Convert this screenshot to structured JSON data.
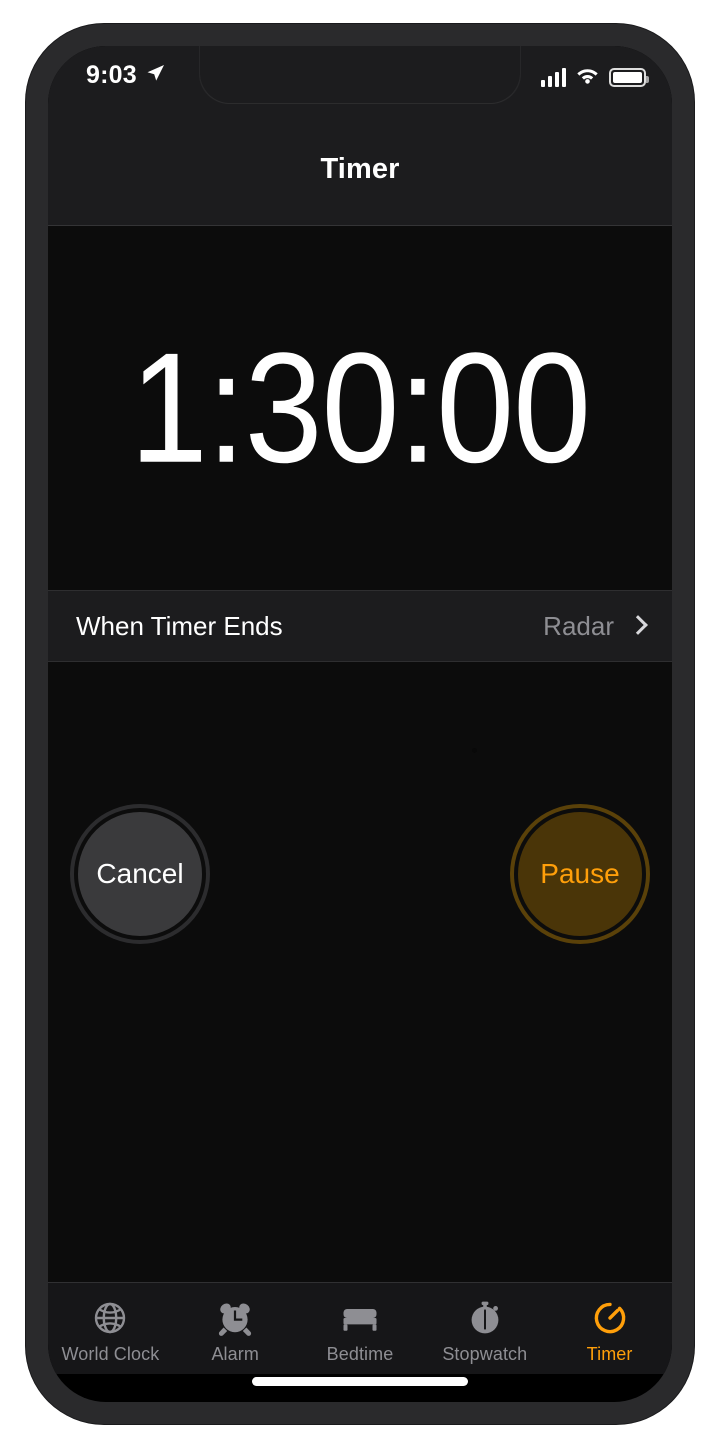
{
  "status_bar": {
    "time": "9:03",
    "location_icon": "location-arrow-icon",
    "signal_icon": "cellular-signal-icon",
    "signal_bars": 4,
    "wifi_icon": "wifi-icon",
    "battery_icon": "battery-full-icon"
  },
  "nav": {
    "title": "Timer"
  },
  "timer": {
    "readout": "1:30:00",
    "hours": "1",
    "minutes": "30",
    "seconds": "00"
  },
  "settings_row": {
    "label": "When Timer Ends",
    "value": "Radar",
    "chevron_icon": "chevron-right-icon"
  },
  "controls": {
    "cancel_label": "Cancel",
    "pause_label": "Pause"
  },
  "tabs": [
    {
      "label": "World Clock",
      "icon": "globe-icon",
      "active": false
    },
    {
      "label": "Alarm",
      "icon": "alarm-clock-icon",
      "active": false
    },
    {
      "label": "Bedtime",
      "icon": "bed-icon",
      "active": false
    },
    {
      "label": "Stopwatch",
      "icon": "stopwatch-icon",
      "active": false
    },
    {
      "label": "Timer",
      "icon": "timer-dial-icon",
      "active": true
    }
  ],
  "colors": {
    "accent": "#ff9f0a",
    "inactive": "#8e8e93",
    "screen_bg": "#0c0c0c",
    "bar_bg": "#1c1c1e",
    "cancel_fill": "#3a3a3c",
    "pause_fill": "#4a3508"
  }
}
